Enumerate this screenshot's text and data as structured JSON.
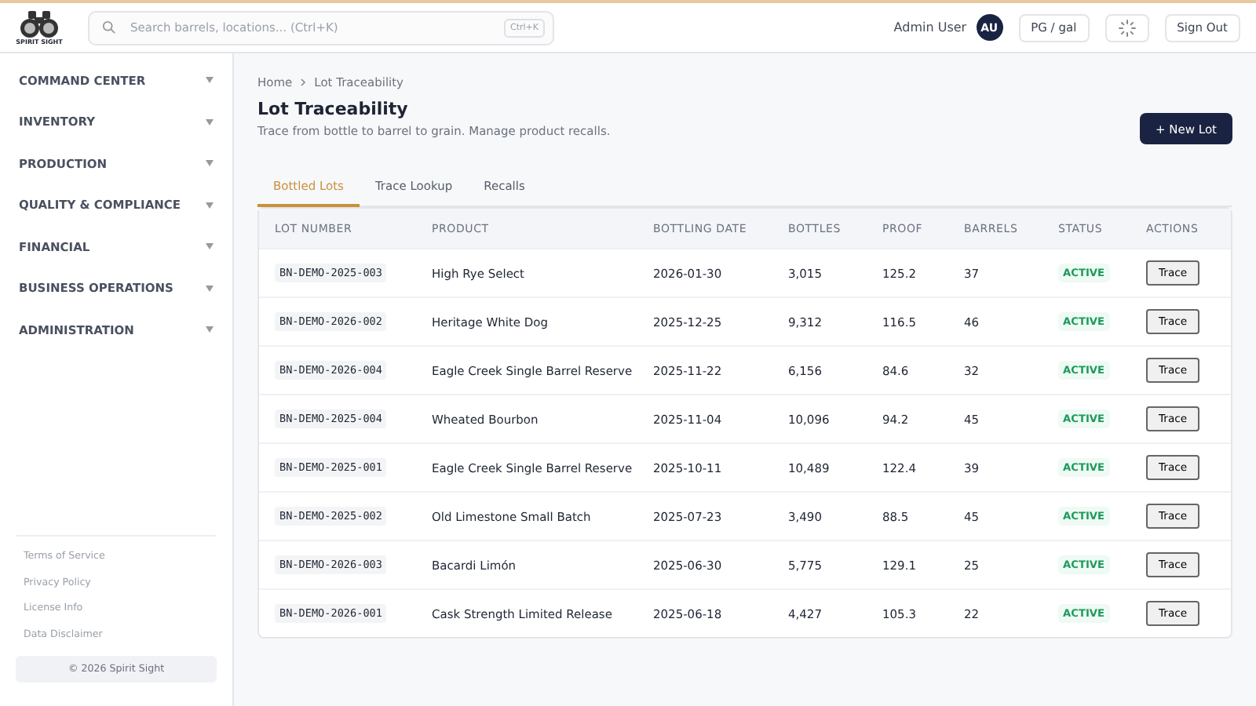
{
  "header": {
    "logo_text": "SPIRIT SIGHT",
    "search": {
      "placeholder": "Search barrels, locations... (Ctrl+K)",
      "shortcut": "Ctrl+K"
    },
    "user_name": "Admin User",
    "avatar": "AU",
    "unit_button": "PG / gal",
    "sign_out": "Sign Out"
  },
  "sidebar": {
    "items": [
      {
        "label": "COMMAND CENTER",
        "expanded": false
      },
      {
        "label": "INVENTORY",
        "expanded": false
      },
      {
        "label": "PRODUCTION",
        "expanded": false
      },
      {
        "label": "QUALITY & COMPLIANCE",
        "expanded": false
      },
      {
        "label": "FINANCIAL",
        "expanded": false
      },
      {
        "label": "BUSINESS OPERATIONS",
        "expanded": false
      },
      {
        "label": "ADMINISTRATION",
        "expanded": false
      }
    ],
    "footer_links": [
      "Terms of Service",
      "Privacy Policy",
      "License Info",
      "Data Disclaimer"
    ],
    "copyright": "© 2026 Spirit Sight"
  },
  "breadcrumb": [
    "Home",
    "Lot Traceability"
  ],
  "page": {
    "title": "Lot Traceability",
    "subtitle": "Trace from bottle to barrel to grain. Manage product recalls.",
    "new_button": "+ New Lot"
  },
  "tabs": [
    {
      "label": "Bottled Lots",
      "selected": true
    },
    {
      "label": "Trace Lookup",
      "selected": false
    },
    {
      "label": "Recalls",
      "selected": false
    }
  ],
  "table": {
    "columns": [
      "LOT NUMBER",
      "PRODUCT",
      "BOTTLING DATE",
      "BOTTLES",
      "PROOF",
      "BARRELS",
      "STATUS",
      "ACTIONS"
    ],
    "rows": [
      {
        "lot": "BN-DEMO-2025-003",
        "product": "High Rye Select",
        "date": "2026-01-30",
        "bottles": "3,015",
        "proof": "125.2",
        "barrels": "37",
        "status": "ACTIVE",
        "kind": "active",
        "action": "Trace"
      },
      {
        "lot": "BN-DEMO-2026-002",
        "product": "Heritage White Dog",
        "date": "2025-12-25",
        "bottles": "9,312",
        "proof": "116.5",
        "barrels": "46",
        "status": "ACTIVE",
        "kind": "active",
        "action": "Trace"
      },
      {
        "lot": "BN-DEMO-2026-004",
        "product": "Eagle Creek Single Barrel Reserve",
        "date": "2025-11-22",
        "bottles": "6,156",
        "proof": "84.6",
        "barrels": "32",
        "status": "ACTIVE",
        "kind": "active",
        "action": "Trace"
      },
      {
        "lot": "BN-DEMO-2025-004",
        "product": "Wheated Bourbon",
        "date": "2025-11-04",
        "bottles": "10,096",
        "proof": "94.2",
        "barrels": "45",
        "status": "ACTIVE",
        "kind": "active",
        "action": "Trace"
      },
      {
        "lot": "BN-DEMO-2025-001",
        "product": "Eagle Creek Single Barrel Reserve",
        "date": "2025-10-11",
        "bottles": "10,489",
        "proof": "122.4",
        "barrels": "39",
        "status": "ACTIVE",
        "kind": "active",
        "action": "Trace"
      },
      {
        "lot": "BN-DEMO-2025-002",
        "product": "Old Limestone Small Batch",
        "date": "2025-07-23",
        "bottles": "3,490",
        "proof": "88.5",
        "barrels": "45",
        "status": "ACTIVE",
        "kind": "active",
        "action": "Trace"
      },
      {
        "lot": "BN-DEMO-2026-003",
        "product": "Bacardi Limón",
        "date": "2025-06-30",
        "bottles": "5,775",
        "proof": "129.1",
        "barrels": "25",
        "status": "ACTIVE",
        "kind": "active",
        "action": "Trace"
      },
      {
        "lot": "BN-DEMO-2026-001",
        "product": "Cask Strength Limited Release",
        "date": "2025-06-18",
        "bottles": "4,427",
        "proof": "105.3",
        "barrels": "22",
        "status": "ACTIVE",
        "kind": "active",
        "action": "Trace"
      }
    ]
  }
}
